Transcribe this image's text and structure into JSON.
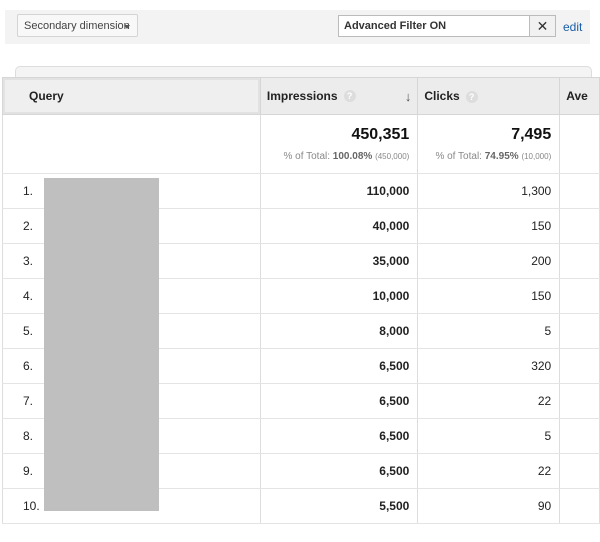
{
  "toolbar": {
    "secondary_dimension": "Secondary dimension",
    "filter_value": "Advanced Filter ON",
    "clear_label": "✕",
    "edit_label": "edit"
  },
  "table": {
    "headers": {
      "query": "Query",
      "impressions": "Impressions",
      "clicks": "Clicks",
      "avg": "Ave",
      "help": "?",
      "sort_arrow": "↓"
    },
    "totals": {
      "impressions": "450,351",
      "impressions_pct_label": "% of Total: ",
      "impressions_pct": "100.08%",
      "impressions_base": "(450,000)",
      "clicks": "7,495",
      "clicks_pct_label": "% of Total: ",
      "clicks_pct": "74.95%",
      "clicks_base": "(10,000)"
    },
    "rows": [
      {
        "idx": "1.",
        "impressions": "110,000",
        "clicks": "1,300"
      },
      {
        "idx": "2.",
        "impressions": "40,000",
        "clicks": "150"
      },
      {
        "idx": "3.",
        "impressions": "35,000",
        "clicks": "200"
      },
      {
        "idx": "4.",
        "impressions": "10,000",
        "clicks": "150"
      },
      {
        "idx": "5.",
        "impressions": "8,000",
        "clicks": "5"
      },
      {
        "idx": "6.",
        "impressions": "6,500",
        "clicks": "320"
      },
      {
        "idx": "7.",
        "impressions": "6,500",
        "clicks": "22"
      },
      {
        "idx": "8.",
        "impressions": "6,500",
        "clicks": "5"
      },
      {
        "idx": "9.",
        "impressions": "6,500",
        "clicks": "22"
      },
      {
        "idx": "10.",
        "impressions": "5,500",
        "clicks": "90"
      }
    ]
  }
}
